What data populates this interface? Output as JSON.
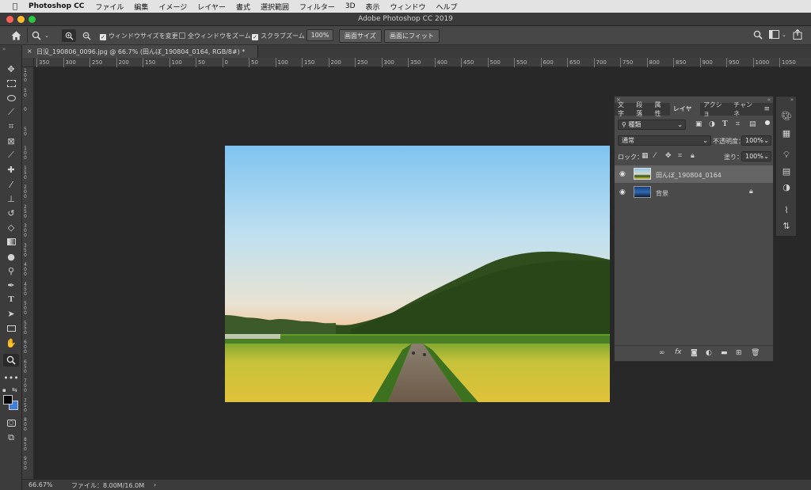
{
  "menubar": {
    "app_name": "Photoshop CC",
    "items": [
      "ファイル",
      "編集",
      "イメージ",
      "レイヤー",
      "書式",
      "選択範囲",
      "フィルター",
      "3D",
      "表示",
      "ウィンドウ",
      "ヘルプ"
    ]
  },
  "window": {
    "title": "Adobe Photoshop CC 2019"
  },
  "options": {
    "resize_windows": "ウィンドウサイズを変更",
    "all_windows": "全ウィンドウをズーム",
    "scrubby_zoom": "スクラブズーム",
    "zoom_value": "100%",
    "fit_screen": "画面サイズ",
    "fill_screen": "画面にフィット"
  },
  "document": {
    "tab_title": "日没_190806_0096.jpg @ 66.7% (田んぼ_190804_0164, RGB/8#) *",
    "close": "×"
  },
  "rulers": {
    "h_ticks": [
      "350",
      "300",
      "250",
      "200",
      "150",
      "100",
      "50",
      "0",
      "50",
      "100",
      "150",
      "200",
      "250",
      "300",
      "350",
      "400",
      "450",
      "500",
      "550",
      "600",
      "650",
      "700",
      "750",
      "800",
      "850",
      "900",
      "950",
      "1000",
      "1050"
    ],
    "v_ticks": [
      "1 0 0",
      "5 0",
      "0",
      "5 0",
      "1 0 0",
      "1 5 0",
      "2 0 0",
      "2 5 0",
      "3 0 0",
      "3 5 0",
      "4 0 0",
      "4 5 0",
      "5 0 0",
      "5 5 0",
      "6 0 0",
      "6 5 0",
      "7 0 0",
      "7 5 0",
      "8 0 0",
      "8 5 0",
      "9 0 0"
    ]
  },
  "layers_panel": {
    "tabs": [
      "文字",
      "段落",
      "属性",
      "レイヤー",
      "アクショ",
      "チャンネ"
    ],
    "active_tab": "レイヤー",
    "filter_kind": "種類",
    "blend_mode": "通常",
    "opacity_label": "不透明度：",
    "opacity_value": "100%",
    "lock_label": "ロック：",
    "fill_label": "塗り：",
    "fill_value": "100%",
    "layers": [
      {
        "name": "田んぼ_190804_0164",
        "selected": true
      },
      {
        "name": "背景",
        "selected": false
      }
    ],
    "footer_icons": [
      "link-icon",
      "fx-icon",
      "mask-icon",
      "adjustment-icon",
      "folder-icon",
      "new-layer-icon",
      "trash-icon"
    ],
    "fx": "fx"
  },
  "status": {
    "zoom": "66.67%",
    "file_info": "ファイル：8.00M/16.0M",
    "arrow": "›"
  },
  "colors": {
    "foreground": "#000000",
    "background": "#3f7fd9"
  }
}
